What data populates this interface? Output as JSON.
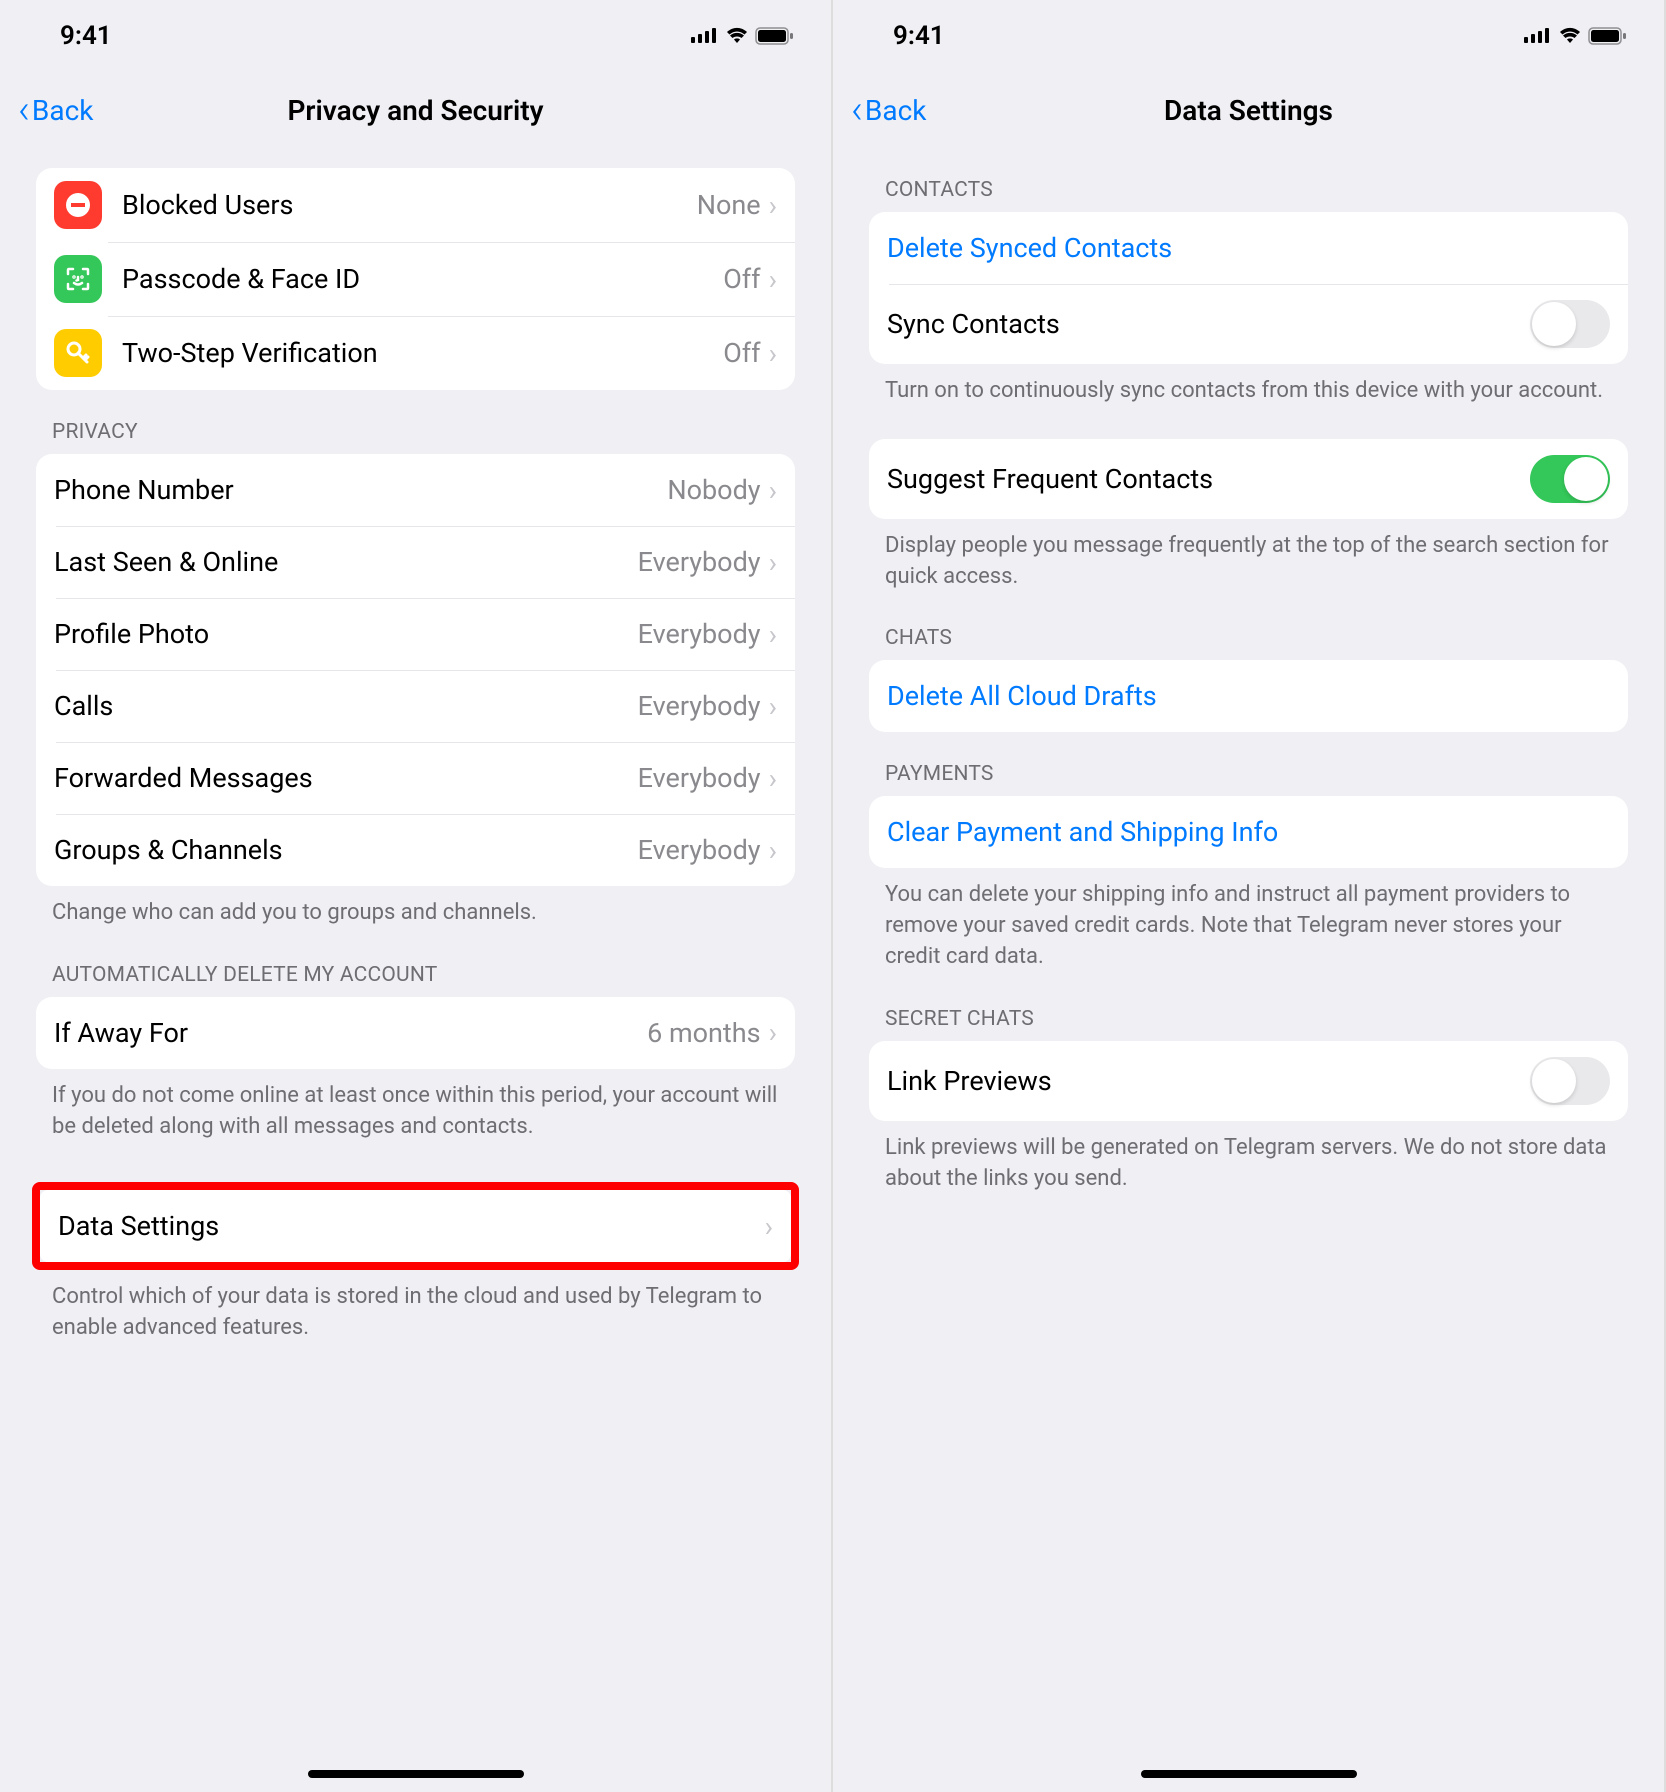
{
  "left": {
    "status_time": "9:41",
    "back_label": "Back",
    "title": "Privacy and Security",
    "security_group": [
      {
        "label": "Blocked Users",
        "value": "None"
      },
      {
        "label": "Passcode & Face ID",
        "value": "Off"
      },
      {
        "label": "Two-Step Verification",
        "value": "Off"
      }
    ],
    "privacy_header": "PRIVACY",
    "privacy_items": [
      {
        "label": "Phone Number",
        "value": "Nobody"
      },
      {
        "label": "Last Seen & Online",
        "value": "Everybody"
      },
      {
        "label": "Profile Photo",
        "value": "Everybody"
      },
      {
        "label": "Calls",
        "value": "Everybody"
      },
      {
        "label": "Forwarded Messages",
        "value": "Everybody"
      },
      {
        "label": "Groups & Channels",
        "value": "Everybody"
      }
    ],
    "privacy_footer": "Change who can add you to groups and channels.",
    "auto_delete_header": "AUTOMATICALLY DELETE MY ACCOUNT",
    "auto_delete_item": {
      "label": "If Away For",
      "value": "6 months"
    },
    "auto_delete_footer": "If you do not come online at least once within this period, your account will be deleted along with all messages and contacts.",
    "data_settings": {
      "label": "Data Settings"
    },
    "data_settings_footer": "Control which of your data is stored in the cloud and used by Telegram to enable advanced features."
  },
  "right": {
    "status_time": "9:41",
    "back_label": "Back",
    "title": "Data Settings",
    "contacts_header": "CONTACTS",
    "delete_synced": "Delete Synced Contacts",
    "sync_contacts": "Sync Contacts",
    "sync_contacts_footer": "Turn on to continuously sync contacts from this device with your account.",
    "suggest_frequent": "Suggest Frequent Contacts",
    "suggest_frequent_footer": "Display people you message frequently at the top of the search section for quick access.",
    "chats_header": "CHATS",
    "delete_drafts": "Delete All Cloud Drafts",
    "payments_header": "PAYMENTS",
    "clear_payment": "Clear Payment and Shipping Info",
    "payments_footer": "You can delete your shipping info and instruct all payment providers to remove your saved credit cards. Note that Telegram never stores your credit card data.",
    "secret_chats_header": "SECRET CHATS",
    "link_previews": "Link Previews",
    "link_previews_footer": "Link previews will be generated on Telegram servers. We do not store data about the links you send."
  }
}
